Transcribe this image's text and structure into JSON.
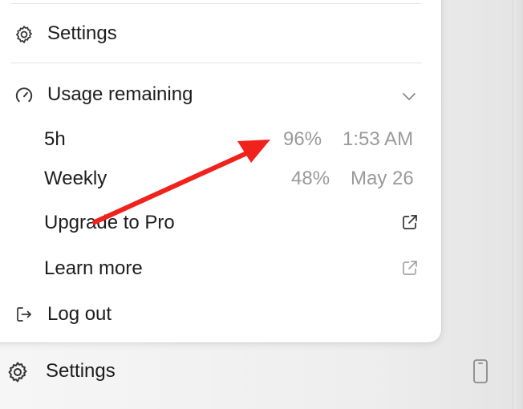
{
  "menu": {
    "settings_label": "Settings",
    "usage": {
      "label": "Usage remaining",
      "rows": [
        {
          "label": "5h",
          "percent": "96%",
          "reset": "1:53 AM"
        },
        {
          "label": "Weekly",
          "percent": "48%",
          "reset": "May 26"
        }
      ]
    },
    "upgrade_label": "Upgrade to Pro",
    "learn_more_label": "Learn more",
    "logout_label": "Log out"
  },
  "bottom_bar": {
    "settings_label": "Settings"
  },
  "colors": {
    "annotation_arrow": "#f0221c",
    "muted_text": "#9a9a9a"
  }
}
